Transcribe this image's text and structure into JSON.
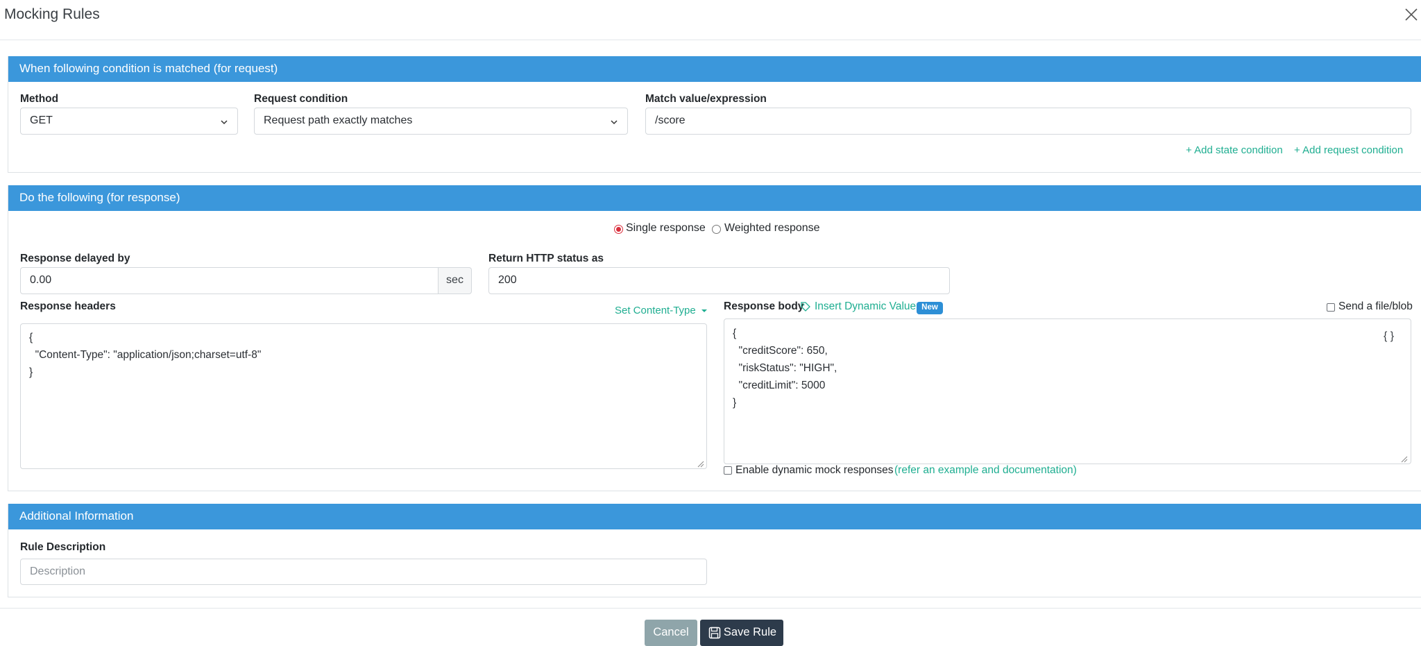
{
  "modal": {
    "title": "Mocking Rules"
  },
  "request_section": {
    "title": "When following condition is matched (for request)",
    "method_label": "Method",
    "method_value": "GET",
    "condition_label": "Request condition",
    "condition_value": "Request path exactly matches",
    "match_label": "Match value/expression",
    "match_value": "/score",
    "add_state_condition": "+ Add state condition",
    "add_request_condition": "+ Add request condition"
  },
  "response_section": {
    "title": "Do the following (for response)",
    "single_response": "Single response",
    "weighted_response": "Weighted response",
    "selected_mode": "single",
    "delay_label": "Response delayed by",
    "delay_value": "0.00",
    "delay_unit": "sec",
    "status_label": "Return HTTP status as",
    "status_value": "200",
    "headers_label": "Response headers",
    "set_content_type": "Set Content-Type",
    "headers_value": "{\n  \"Content-Type\": \"application/json;charset=utf-8\"\n}",
    "body_label": "Response body",
    "insert_dynamic_value": "Insert Dynamic Value",
    "new_badge": "New",
    "send_file_label": "Send a file/blob",
    "body_value": "{\n  \"creditScore\": 650,\n  \"riskStatus\": \"HIGH\",\n  \"creditLimit\": 5000\n}",
    "format_button": "{ }",
    "enable_dynamic_label": "Enable dynamic mock responses",
    "enable_dynamic_link": "(refer an example and documentation)"
  },
  "additional_section": {
    "title": "Additional Information",
    "description_label": "Rule Description",
    "description_placeholder": "Description"
  },
  "footer": {
    "cancel_label": "Cancel",
    "save_label": "Save Rule"
  },
  "colors": {
    "panel_header": "#3b97db",
    "link": "#1fae91",
    "save_button": "#2d3b4b",
    "cancel_button": "#8fa5aa",
    "radio_selected": "#d92f3d"
  }
}
